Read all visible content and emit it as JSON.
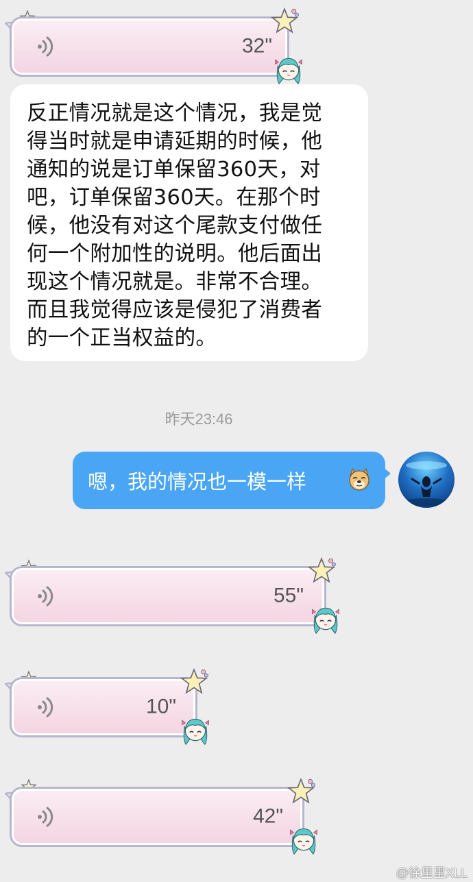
{
  "voice_messages": [
    {
      "duration": "32\""
    },
    {
      "duration": "55\""
    },
    {
      "duration": "10\""
    },
    {
      "duration": "42\""
    }
  ],
  "text_message": {
    "lines": [
      "反正情况就是这个情况，我是觉",
      "得当时就是申请延期的时候，他",
      "通知的说是订单保留360天，对",
      "吧，订单保留360天。在那个时",
      "候，他没有对这个尾款支付做任",
      "何一个附加性的说明。他后面出",
      "现这个情况就是。非常不合理。",
      "而且我觉得应该是侵犯了消费者",
      "的一个正当权益的。"
    ]
  },
  "timestamp": "昨天23:46",
  "sent_message": {
    "text": "嗯，我的情况也一模一样",
    "emoji": "doge-emoji"
  },
  "watermark": "@徐里里XLL",
  "colors": {
    "background": "#ededed",
    "sent_bubble": "#4aa6f4",
    "voice_bubble_border": "#b7b6cf",
    "voice_bubble_fill": "#f3d4e2"
  }
}
